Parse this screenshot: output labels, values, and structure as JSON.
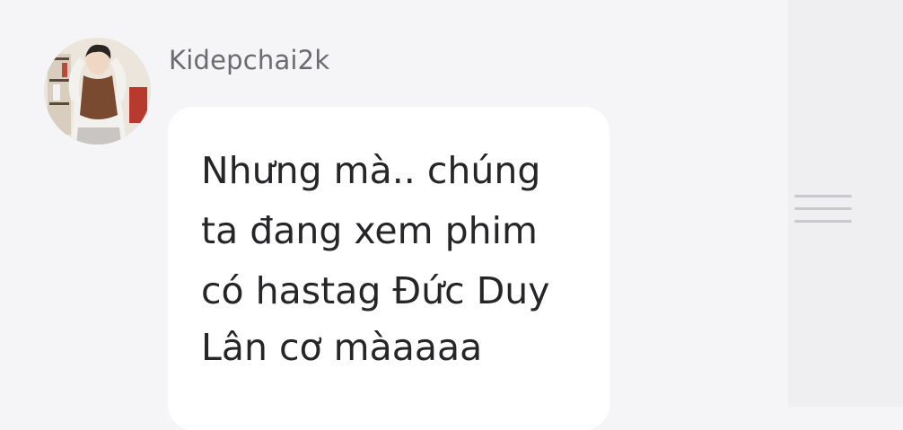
{
  "message": {
    "sender": "Kidepchai2k",
    "lines": [
      "Nhưng mà.. chúng",
      "ta đang xem phim",
      "có hastag Đức Duy",
      "Lân cơ màaaaa"
    ]
  },
  "icons": {
    "avatar": "profile-photo",
    "menu": "menu-handle-icon"
  },
  "colors": {
    "background": "#f5f5f7",
    "bubble": "#ffffff",
    "text": "#262629",
    "username": "#6b6b70",
    "menu_bars": "#c9c9cd"
  }
}
